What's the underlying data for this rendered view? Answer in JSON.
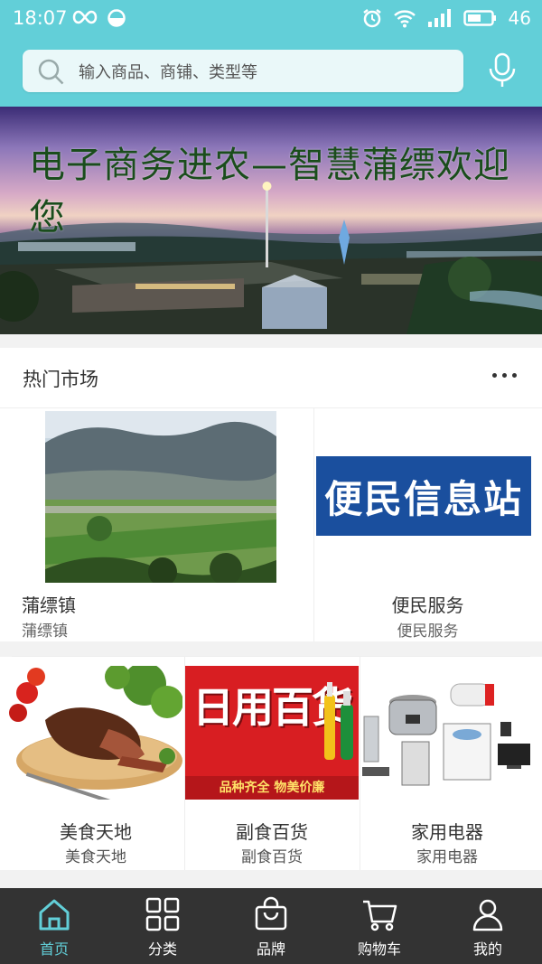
{
  "status_bar": {
    "time": "18:07",
    "battery": "46"
  },
  "search": {
    "placeholder": "输入商品、商铺、类型等"
  },
  "banner": {
    "title": "电子商务进农—智慧蒲缥欢迎您"
  },
  "market": {
    "title": "热门市场",
    "featured": [
      {
        "title": "蒲缥镇",
        "subtitle": "蒲缥镇"
      },
      {
        "title": "便民服务",
        "subtitle": "便民服务",
        "image_text": "便民信息站"
      }
    ],
    "items": [
      {
        "title": "美食天地",
        "subtitle": "美食天地"
      },
      {
        "title": "副食百货",
        "subtitle": "副食百货",
        "image_text": "日用百货",
        "image_caption": "品种齐全 物美价廉"
      },
      {
        "title": "家用电器",
        "subtitle": "家用电器"
      }
    ]
  },
  "tabs": [
    {
      "label": "首页",
      "icon": "home-icon",
      "active": true
    },
    {
      "label": "分类",
      "icon": "grid-icon"
    },
    {
      "label": "品牌",
      "icon": "bag-icon"
    },
    {
      "label": "购物车",
      "icon": "cart-icon"
    },
    {
      "label": "我的",
      "icon": "user-icon"
    }
  ],
  "colors": {
    "accent": "#62cfd8",
    "tab_bar": "#333333"
  }
}
